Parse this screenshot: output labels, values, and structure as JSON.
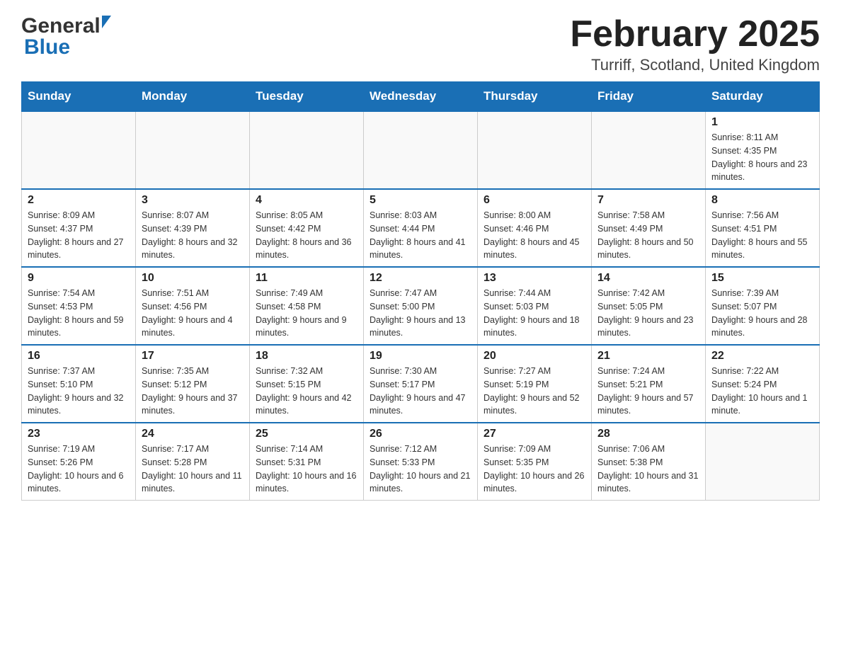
{
  "header": {
    "month_title": "February 2025",
    "location": "Turriff, Scotland, United Kingdom",
    "logo_general": "General",
    "logo_blue": "Blue"
  },
  "days_of_week": [
    "Sunday",
    "Monday",
    "Tuesday",
    "Wednesday",
    "Thursday",
    "Friday",
    "Saturday"
  ],
  "weeks": [
    {
      "cells": [
        {
          "day": "",
          "info": ""
        },
        {
          "day": "",
          "info": ""
        },
        {
          "day": "",
          "info": ""
        },
        {
          "day": "",
          "info": ""
        },
        {
          "day": "",
          "info": ""
        },
        {
          "day": "",
          "info": ""
        },
        {
          "day": "1",
          "info": "Sunrise: 8:11 AM\nSunset: 4:35 PM\nDaylight: 8 hours and 23 minutes."
        }
      ]
    },
    {
      "cells": [
        {
          "day": "2",
          "info": "Sunrise: 8:09 AM\nSunset: 4:37 PM\nDaylight: 8 hours and 27 minutes."
        },
        {
          "day": "3",
          "info": "Sunrise: 8:07 AM\nSunset: 4:39 PM\nDaylight: 8 hours and 32 minutes."
        },
        {
          "day": "4",
          "info": "Sunrise: 8:05 AM\nSunset: 4:42 PM\nDaylight: 8 hours and 36 minutes."
        },
        {
          "day": "5",
          "info": "Sunrise: 8:03 AM\nSunset: 4:44 PM\nDaylight: 8 hours and 41 minutes."
        },
        {
          "day": "6",
          "info": "Sunrise: 8:00 AM\nSunset: 4:46 PM\nDaylight: 8 hours and 45 minutes."
        },
        {
          "day": "7",
          "info": "Sunrise: 7:58 AM\nSunset: 4:49 PM\nDaylight: 8 hours and 50 minutes."
        },
        {
          "day": "8",
          "info": "Sunrise: 7:56 AM\nSunset: 4:51 PM\nDaylight: 8 hours and 55 minutes."
        }
      ]
    },
    {
      "cells": [
        {
          "day": "9",
          "info": "Sunrise: 7:54 AM\nSunset: 4:53 PM\nDaylight: 8 hours and 59 minutes."
        },
        {
          "day": "10",
          "info": "Sunrise: 7:51 AM\nSunset: 4:56 PM\nDaylight: 9 hours and 4 minutes."
        },
        {
          "day": "11",
          "info": "Sunrise: 7:49 AM\nSunset: 4:58 PM\nDaylight: 9 hours and 9 minutes."
        },
        {
          "day": "12",
          "info": "Sunrise: 7:47 AM\nSunset: 5:00 PM\nDaylight: 9 hours and 13 minutes."
        },
        {
          "day": "13",
          "info": "Sunrise: 7:44 AM\nSunset: 5:03 PM\nDaylight: 9 hours and 18 minutes."
        },
        {
          "day": "14",
          "info": "Sunrise: 7:42 AM\nSunset: 5:05 PM\nDaylight: 9 hours and 23 minutes."
        },
        {
          "day": "15",
          "info": "Sunrise: 7:39 AM\nSunset: 5:07 PM\nDaylight: 9 hours and 28 minutes."
        }
      ]
    },
    {
      "cells": [
        {
          "day": "16",
          "info": "Sunrise: 7:37 AM\nSunset: 5:10 PM\nDaylight: 9 hours and 32 minutes."
        },
        {
          "day": "17",
          "info": "Sunrise: 7:35 AM\nSunset: 5:12 PM\nDaylight: 9 hours and 37 minutes."
        },
        {
          "day": "18",
          "info": "Sunrise: 7:32 AM\nSunset: 5:15 PM\nDaylight: 9 hours and 42 minutes."
        },
        {
          "day": "19",
          "info": "Sunrise: 7:30 AM\nSunset: 5:17 PM\nDaylight: 9 hours and 47 minutes."
        },
        {
          "day": "20",
          "info": "Sunrise: 7:27 AM\nSunset: 5:19 PM\nDaylight: 9 hours and 52 minutes."
        },
        {
          "day": "21",
          "info": "Sunrise: 7:24 AM\nSunset: 5:21 PM\nDaylight: 9 hours and 57 minutes."
        },
        {
          "day": "22",
          "info": "Sunrise: 7:22 AM\nSunset: 5:24 PM\nDaylight: 10 hours and 1 minute."
        }
      ]
    },
    {
      "cells": [
        {
          "day": "23",
          "info": "Sunrise: 7:19 AM\nSunset: 5:26 PM\nDaylight: 10 hours and 6 minutes."
        },
        {
          "day": "24",
          "info": "Sunrise: 7:17 AM\nSunset: 5:28 PM\nDaylight: 10 hours and 11 minutes."
        },
        {
          "day": "25",
          "info": "Sunrise: 7:14 AM\nSunset: 5:31 PM\nDaylight: 10 hours and 16 minutes."
        },
        {
          "day": "26",
          "info": "Sunrise: 7:12 AM\nSunset: 5:33 PM\nDaylight: 10 hours and 21 minutes."
        },
        {
          "day": "27",
          "info": "Sunrise: 7:09 AM\nSunset: 5:35 PM\nDaylight: 10 hours and 26 minutes."
        },
        {
          "day": "28",
          "info": "Sunrise: 7:06 AM\nSunset: 5:38 PM\nDaylight: 10 hours and 31 minutes."
        },
        {
          "day": "",
          "info": ""
        }
      ]
    }
  ]
}
